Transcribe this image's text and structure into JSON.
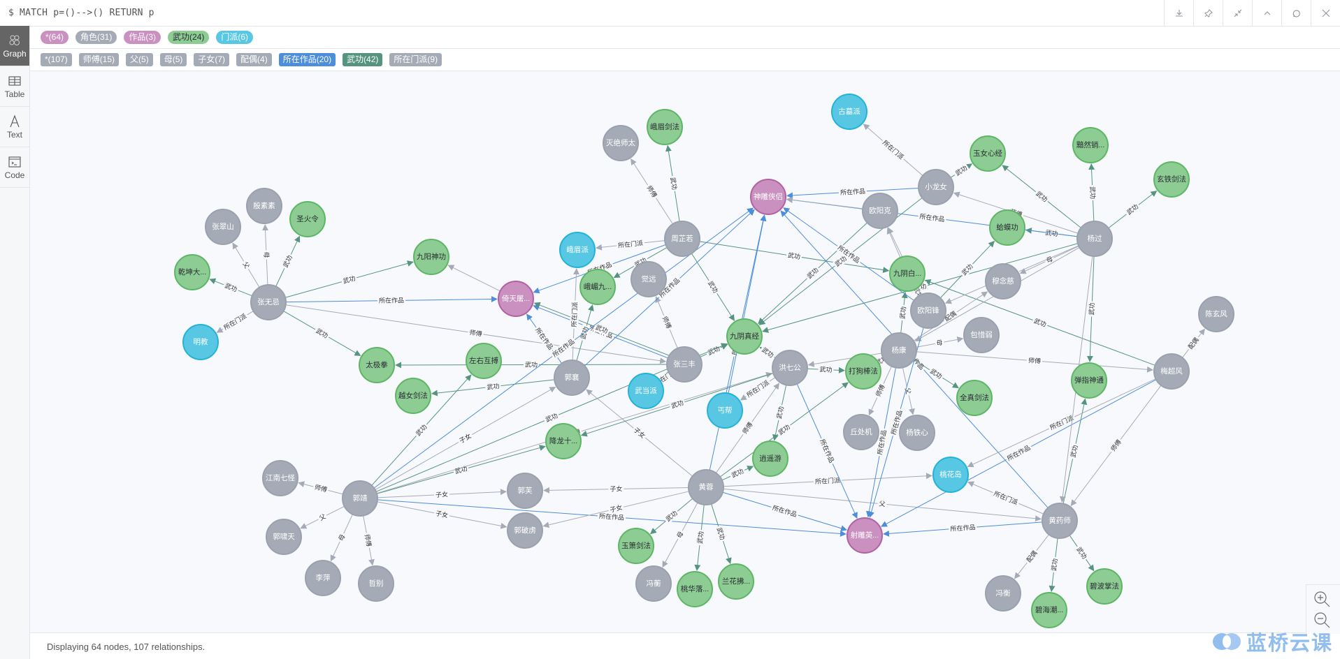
{
  "query": "$ MATCH p=()-->() RETURN p",
  "toolbar": {
    "buttons": [
      {
        "name": "download-icon"
      },
      {
        "name": "pin-icon"
      },
      {
        "name": "collapse-icon"
      },
      {
        "name": "chevron-up-icon"
      },
      {
        "name": "refresh-icon"
      },
      {
        "name": "close-icon"
      }
    ]
  },
  "sidebar": {
    "tabs": [
      {
        "label": "Graph",
        "icon": "graph-icon",
        "active": true
      },
      {
        "label": "Table",
        "icon": "table-icon",
        "active": false
      },
      {
        "label": "Text",
        "icon": "text-icon",
        "active": false
      },
      {
        "label": "Code",
        "icon": "code-icon",
        "active": false
      }
    ]
  },
  "node_labels": [
    {
      "text": "*(64)",
      "color": "#c990c0",
      "fg": "#ffffff"
    },
    {
      "text": "角色(31)",
      "color": "#a5abb6",
      "fg": "#ffffff"
    },
    {
      "text": "作品(3)",
      "color": "#c990c0",
      "fg": "#ffffff"
    },
    {
      "text": "武功(24)",
      "color": "#8dcc93",
      "fg": "#2a2c34"
    },
    {
      "text": "门派(6)",
      "color": "#57c7e3",
      "fg": "#ffffff"
    }
  ],
  "rel_types": [
    {
      "text": "*(107)",
      "color": "#a5abb6"
    },
    {
      "text": "师傅(15)",
      "color": "#a5abb6"
    },
    {
      "text": "父(5)",
      "color": "#a5abb6"
    },
    {
      "text": "母(5)",
      "color": "#a5abb6"
    },
    {
      "text": "子女(7)",
      "color": "#a5abb6"
    },
    {
      "text": "配偶(4)",
      "color": "#a5abb6"
    },
    {
      "text": "所在作品(20)",
      "color": "#4c8eda"
    },
    {
      "text": "武功(42)",
      "color": "#569480"
    },
    {
      "text": "所在门派(9)",
      "color": "#a5abb6"
    }
  ],
  "category_colors": {
    "角色": {
      "fill": "#a5abb6",
      "stroke": "#9aa1ac",
      "text": "#ffffff"
    },
    "作品": {
      "fill": "#c990c0",
      "stroke": "#b261a5",
      "text": "#ffffff"
    },
    "武功": {
      "fill": "#8dcc93",
      "stroke": "#5db665",
      "text": "#2a2c34"
    },
    "门派": {
      "fill": "#57c7e3",
      "stroke": "#23b3d7",
      "text": "#ffffff"
    }
  },
  "edge_colors": {
    "所在作品": "#4c8eda",
    "武功": "#569480",
    "default": "#a5abb6"
  },
  "nodes": [
    {
      "id": "zwj",
      "label": "张无忌",
      "cat": "角色"
    },
    {
      "id": "zcs",
      "label": "张翠山",
      "cat": "角色"
    },
    {
      "id": "yss",
      "label": "殷素素",
      "cat": "角色"
    },
    {
      "id": "shl",
      "label": "圣火令",
      "cat": "武功"
    },
    {
      "id": "qkd",
      "label": "乾坤大...",
      "cat": "武功"
    },
    {
      "id": "mj",
      "label": "明教",
      "cat": "门派"
    },
    {
      "id": "jysg",
      "label": "九阳神功",
      "cat": "武功"
    },
    {
      "id": "yttl",
      "label": "倚天屠...",
      "cat": "作品"
    },
    {
      "id": "tjq",
      "label": "太极拳",
      "cat": "武功"
    },
    {
      "id": "zyhb",
      "label": "左右互搏",
      "cat": "武功"
    },
    {
      "id": "ynjf",
      "label": "越女剑法",
      "cat": "武功"
    },
    {
      "id": "mjst",
      "label": "灭绝师太",
      "cat": "角色"
    },
    {
      "id": "emjf",
      "label": "峨眉剑法",
      "cat": "武功"
    },
    {
      "id": "zzr",
      "label": "周芷若",
      "cat": "角色"
    },
    {
      "id": "emp",
      "label": "峨眉派",
      "cat": "门派"
    },
    {
      "id": "emj",
      "label": "峨嵋九...",
      "cat": "武功"
    },
    {
      "id": "jy",
      "label": "觉远",
      "cat": "角色"
    },
    {
      "id": "sdxl",
      "label": "神雕侠侣",
      "cat": "作品"
    },
    {
      "id": "gmp",
      "label": "古墓派",
      "cat": "门派"
    },
    {
      "id": "xln",
      "label": "小龙女",
      "cat": "角色"
    },
    {
      "id": "oyk",
      "label": "欧阳克",
      "cat": "角色"
    },
    {
      "id": "ynxj",
      "label": "玉女心经",
      "cat": "武功"
    },
    {
      "id": "arx",
      "label": "黯然销...",
      "cat": "武功"
    },
    {
      "id": "xtjf",
      "label": "玄铁剑法",
      "cat": "武功"
    },
    {
      "id": "hmg",
      "label": "蛤蟆功",
      "cat": "武功"
    },
    {
      "id": "yg",
      "label": "杨过",
      "cat": "角色"
    },
    {
      "id": "jybz",
      "label": "九阴白...",
      "cat": "武功"
    },
    {
      "id": "mnc",
      "label": "穆念慈",
      "cat": "角色"
    },
    {
      "id": "oyf",
      "label": "欧阳锋",
      "cat": "角色"
    },
    {
      "id": "bxr",
      "label": "包惜弱",
      "cat": "角色"
    },
    {
      "id": "cxf",
      "label": "陈玄风",
      "cat": "角色"
    },
    {
      "id": "yk",
      "label": "杨康",
      "cat": "角色"
    },
    {
      "id": "jyzj",
      "label": "九阴真经",
      "cat": "武功"
    },
    {
      "id": "zsf",
      "label": "张三丰",
      "cat": "角色"
    },
    {
      "id": "gx",
      "label": "郭襄",
      "cat": "角色"
    },
    {
      "id": "wdp",
      "label": "武当派",
      "cat": "门派"
    },
    {
      "id": "gb",
      "label": "丐帮",
      "cat": "门派"
    },
    {
      "id": "hqg",
      "label": "洪七公",
      "cat": "角色"
    },
    {
      "id": "dgbf",
      "label": "打狗棒法",
      "cat": "武功"
    },
    {
      "id": "qzjf",
      "label": "全真剑法",
      "cat": "武功"
    },
    {
      "id": "tzst",
      "label": "弹指神通",
      "cat": "武功"
    },
    {
      "id": "mcf",
      "label": "梅超风",
      "cat": "角色"
    },
    {
      "id": "qcj",
      "label": "丘处机",
      "cat": "角色"
    },
    {
      "id": "ytx",
      "label": "杨铁心",
      "cat": "角色"
    },
    {
      "id": "xlsb",
      "label": "降龙十...",
      "cat": "武功"
    },
    {
      "id": "xyy",
      "label": "逍遥游",
      "cat": "武功"
    },
    {
      "id": "hr",
      "label": "黄蓉",
      "cat": "角色"
    },
    {
      "id": "thd",
      "label": "桃花岛",
      "cat": "门派"
    },
    {
      "id": "hys",
      "label": "黄药师",
      "cat": "角色"
    },
    {
      "id": "sdyx",
      "label": "射雕英...",
      "cat": "作品"
    },
    {
      "id": "gj",
      "label": "郭靖",
      "cat": "角色"
    },
    {
      "id": "jnqg",
      "label": "江南七怪",
      "cat": "角色"
    },
    {
      "id": "gxt",
      "label": "郭啸天",
      "cat": "角色"
    },
    {
      "id": "lp",
      "label": "李萍",
      "cat": "角色"
    },
    {
      "id": "zb",
      "label": "哲别",
      "cat": "角色"
    },
    {
      "id": "gf",
      "label": "郭芙",
      "cat": "角色"
    },
    {
      "id": "gpl",
      "label": "郭破虏",
      "cat": "角色"
    },
    {
      "id": "yxjf",
      "label": "玉箫剑法",
      "cat": "武功"
    },
    {
      "id": "fh1",
      "label": "冯蘅",
      "cat": "角色"
    },
    {
      "id": "thl",
      "label": "桃华落...",
      "cat": "武功"
    },
    {
      "id": "lhf",
      "label": "兰花拂...",
      "cat": "武功"
    },
    {
      "id": "fh2",
      "label": "冯衡",
      "cat": "角色"
    },
    {
      "id": "bhc",
      "label": "碧海潮...",
      "cat": "武功"
    },
    {
      "id": "bbzf",
      "label": "碧波掌法",
      "cat": "武功"
    }
  ],
  "edges": [
    {
      "s": "zwj",
      "t": "zcs",
      "type": "父"
    },
    {
      "s": "zwj",
      "t": "yss",
      "type": "母"
    },
    {
      "s": "zwj",
      "t": "shl",
      "type": "武功"
    },
    {
      "s": "zwj",
      "t": "qkd",
      "type": "武功"
    },
    {
      "s": "zwj",
      "t": "mj",
      "type": "所在门派"
    },
    {
      "s": "zwj",
      "t": "jysg",
      "type": "武功"
    },
    {
      "s": "zwj",
      "t": "yttl",
      "type": "所在作品"
    },
    {
      "s": "zwj",
      "t": "tjq",
      "type": "武功"
    },
    {
      "s": "zwj",
      "t": "zsf",
      "type": "师傅"
    },
    {
      "s": "yttl",
      "t": "jysg",
      "type": "",
      "hide": true
    },
    {
      "s": "zsf",
      "t": "tjq",
      "type": "武功"
    },
    {
      "s": "zsf",
      "t": "yttl",
      "type": "所在作品"
    },
    {
      "s": "zsf",
      "t": "wdp",
      "type": "所在门派"
    },
    {
      "s": "zsf",
      "t": "jyzj",
      "type": "武功"
    },
    {
      "s": "zsf",
      "t": "jy",
      "type": "师傅"
    },
    {
      "s": "zsf",
      "t": "yttl",
      "type": "武功",
      "alt": true
    },
    {
      "s": "zzr",
      "t": "mjst",
      "type": "师傅"
    },
    {
      "s": "zzr",
      "t": "emjf",
      "type": "武功"
    },
    {
      "s": "zzr",
      "t": "emp",
      "type": "所在门派"
    },
    {
      "s": "zzr",
      "t": "emj",
      "type": "武功"
    },
    {
      "s": "zzr",
      "t": "yttl",
      "type": "所在作品"
    },
    {
      "s": "zzr",
      "t": "jyzj",
      "type": "武功"
    },
    {
      "s": "zzr",
      "t": "jybz",
      "type": "武功"
    },
    {
      "s": "gx",
      "t": "yttl",
      "type": "所在作品"
    },
    {
      "s": "gx",
      "t": "emp",
      "type": "所在门派"
    },
    {
      "s": "gx",
      "t": "emj",
      "type": "武功"
    },
    {
      "s": "gx",
      "t": "ynjf",
      "type": "武功"
    },
    {
      "s": "gx",
      "t": "sdxl",
      "type": "所在作品"
    },
    {
      "s": "gj",
      "t": "gx",
      "type": "子女"
    },
    {
      "s": "gj",
      "t": "jnqg",
      "type": "师傅"
    },
    {
      "s": "gj",
      "t": "gxt",
      "type": "父"
    },
    {
      "s": "gj",
      "t": "lp",
      "type": "母"
    },
    {
      "s": "gj",
      "t": "zb",
      "type": "师傅"
    },
    {
      "s": "gj",
      "t": "gf",
      "type": "子女"
    },
    {
      "s": "gj",
      "t": "gpl",
      "type": "子女"
    },
    {
      "s": "gj",
      "t": "zyhb",
      "type": "武功"
    },
    {
      "s": "gj",
      "t": "xlsb",
      "type": "武功"
    },
    {
      "s": "gj",
      "t": "jyzj",
      "type": "武功"
    },
    {
      "s": "gj",
      "t": "sdxl",
      "type": "所在作品"
    },
    {
      "s": "gj",
      "t": "sdyx",
      "type": "所在作品"
    },
    {
      "s": "gj",
      "t": "hqg",
      "type": "师傅"
    },
    {
      "s": "hr",
      "t": "gx",
      "type": "子女"
    },
    {
      "s": "hr",
      "t": "gf",
      "type": "子女"
    },
    {
      "s": "hr",
      "t": "gpl",
      "type": "子女"
    },
    {
      "s": "hr",
      "t": "xyy",
      "type": "武功"
    },
    {
      "s": "hr",
      "t": "thd",
      "type": "所在门派"
    },
    {
      "s": "hr",
      "t": "hys",
      "type": "父"
    },
    {
      "s": "hr",
      "t": "sdyx",
      "type": "所在作品"
    },
    {
      "s": "hr",
      "t": "yxjf",
      "type": "武功"
    },
    {
      "s": "hr",
      "t": "fh1",
      "type": "母"
    },
    {
      "s": "hr",
      "t": "thl",
      "type": "武功"
    },
    {
      "s": "hr",
      "t": "lhf",
      "type": "武功"
    },
    {
      "s": "hr",
      "t": "hqg",
      "type": "师傅"
    },
    {
      "s": "hr",
      "t": "sdxl",
      "type": "所在作品"
    },
    {
      "s": "hr",
      "t": "dgbf",
      "type": "武功"
    },
    {
      "s": "hqg",
      "t": "jyzj",
      "type": "武功"
    },
    {
      "s": "hqg",
      "t": "dgbf",
      "type": "武功"
    },
    {
      "s": "hqg",
      "t": "gb",
      "type": "所在门派"
    },
    {
      "s": "hqg",
      "t": "xyy",
      "type": "武功"
    },
    {
      "s": "hqg",
      "t": "xlsb",
      "type": "武功"
    },
    {
      "s": "hqg",
      "t": "sdyx",
      "type": "所在作品"
    },
    {
      "s": "gb",
      "t": "sdxl",
      "type": "所在作品",
      "hide": true
    },
    {
      "s": "hys",
      "t": "thd",
      "type": "所在门派"
    },
    {
      "s": "hys",
      "t": "sdyx",
      "type": "所在作品"
    },
    {
      "s": "hys",
      "t": "fh2",
      "type": "配偶"
    },
    {
      "s": "hys",
      "t": "bhc",
      "type": "武功"
    },
    {
      "s": "hys",
      "t": "bbzf",
      "type": "武功"
    },
    {
      "s": "hys",
      "t": "tzst",
      "type": "武功"
    },
    {
      "s": "hys",
      "t": "sdxl",
      "type": "所在作品"
    },
    {
      "s": "mcf",
      "t": "cxf",
      "type": "配偶"
    },
    {
      "s": "mcf",
      "t": "thd",
      "type": "所在门派"
    },
    {
      "s": "mcf",
      "t": "sdyx",
      "type": "所在作品"
    },
    {
      "s": "mcf",
      "t": "hys",
      "type": "师傅"
    },
    {
      "s": "mcf",
      "t": "jybz",
      "type": "武功"
    },
    {
      "s": "yk",
      "t": "bxr",
      "type": "母"
    },
    {
      "s": "yk",
      "t": "mcf",
      "type": "师傅"
    },
    {
      "s": "yk",
      "t": "qzjf",
      "type": "武功"
    },
    {
      "s": "yk",
      "t": "dgbf",
      "type": "武功"
    },
    {
      "s": "yk",
      "t": "qcj",
      "type": "师傅"
    },
    {
      "s": "yk",
      "t": "ytx",
      "type": "父"
    },
    {
      "s": "yk",
      "t": "sdyx",
      "type": "所在作品"
    },
    {
      "s": "yk",
      "t": "jybz",
      "type": "武功"
    },
    {
      "s": "yk",
      "t": "mnc",
      "type": "配偶"
    },
    {
      "s": "yk",
      "t": "hqg",
      "type": "",
      "hide": true
    },
    {
      "s": "yg",
      "t": "ynxj",
      "type": "武功"
    },
    {
      "s": "yg",
      "t": "arx",
      "type": "武功"
    },
    {
      "s": "yg",
      "t": "xtjf",
      "type": "武功"
    },
    {
      "s": "yg",
      "t": "hmg",
      "type": "武功"
    },
    {
      "s": "yg",
      "t": "mnc",
      "type": "母"
    },
    {
      "s": "yg",
      "t": "xln",
      "type": "师傅"
    },
    {
      "s": "yg",
      "t": "tzst",
      "type": "武功"
    },
    {
      "s": "yg",
      "t": "sdxl",
      "type": "所在作品"
    },
    {
      "s": "yg",
      "t": "oyf",
      "type": "师傅"
    },
    {
      "s": "yg",
      "t": "jyzj",
      "type": "武功"
    },
    {
      "s": "yg",
      "t": "yk",
      "type": "父"
    },
    {
      "s": "yg",
      "t": "hys",
      "type": "",
      "hide": true
    },
    {
      "s": "xln",
      "t": "gmp",
      "type": "所在门派"
    },
    {
      "s": "xln",
      "t": "ynxj",
      "type": "武功"
    },
    {
      "s": "xln",
      "t": "sdxl",
      "type": "所在作品"
    },
    {
      "s": "xln",
      "t": "jyzj",
      "type": "武功"
    },
    {
      "s": "oyk",
      "t": "jyzj",
      "type": "武功"
    },
    {
      "s": "oyk",
      "t": "sdxl",
      "type": "",
      "hide": true
    },
    {
      "s": "jybz",
      "t": "oyk",
      "type": "",
      "hide": true
    },
    {
      "s": "oyf",
      "t": "hmg",
      "type": "武功"
    },
    {
      "s": "oyf",
      "t": "sdxl",
      "type": "所在作品"
    },
    {
      "s": "oyf",
      "t": "jybz",
      "type": "武功"
    },
    {
      "s": "oyf",
      "t": "sdyx",
      "type": "所在作品"
    },
    {
      "s": "oyf",
      "t": "oyk",
      "type": "父"
    }
  ],
  "status": "Displaying 64 nodes, 107 relationships.",
  "zoom_controls": {
    "zoom_in": "zoom-in-icon",
    "zoom_out": "zoom-out-icon"
  },
  "watermark": "蓝桥云课"
}
